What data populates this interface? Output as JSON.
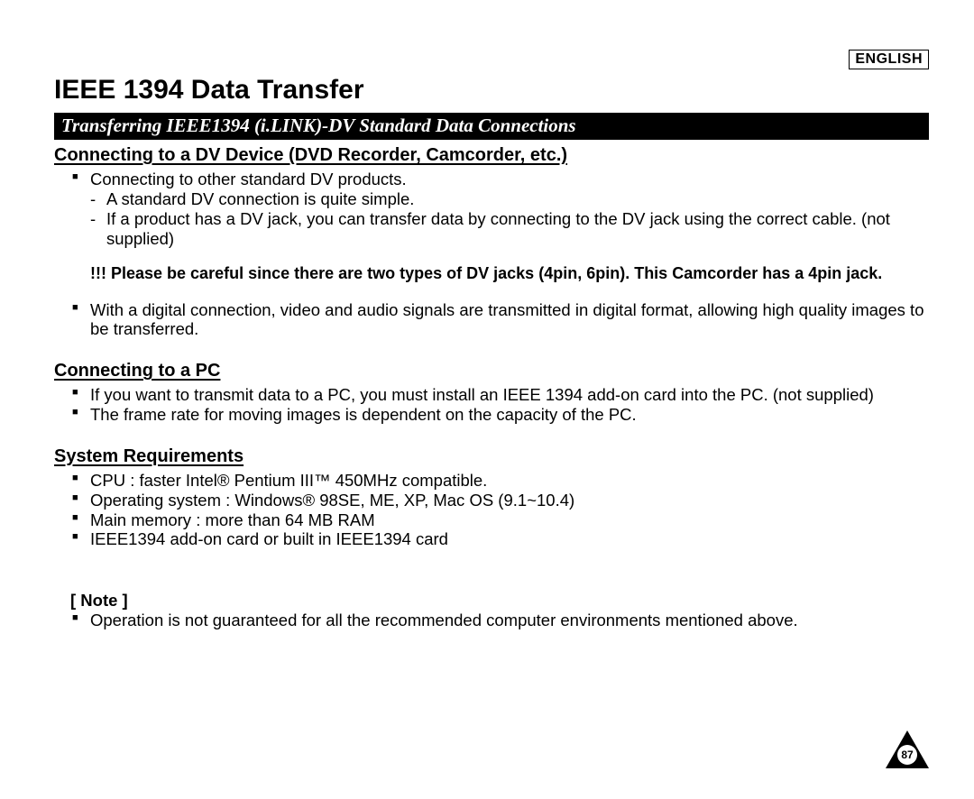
{
  "language_label": "ENGLISH",
  "page_title": "IEEE 1394 Data Transfer",
  "subtitle": "Transferring IEEE1394 (i.LINK)-DV Standard Data Connections",
  "section1": {
    "heading": "Connecting to a DV Device (DVD Recorder, Camcorder, etc.)",
    "bullet1": "Connecting to other standard DV products.",
    "dash1": "A standard DV connection is quite simple.",
    "dash2": "If a product has a DV jack, you can transfer data by connecting to the DV jack using the correct cable. (not supplied)",
    "warning": "!!! Please be careful since there are two types of DV jacks (4pin, 6pin). This Camcorder has a 4pin jack.",
    "bullet2": "With a digital connection, video and audio signals are transmitted in digital format, allowing high quality images to be transferred."
  },
  "section2": {
    "heading": "Connecting to a PC",
    "bullet1": "If you want to transmit data to a PC, you must install an IEEE 1394 add-on card into the PC. (not supplied)",
    "bullet2": "The frame rate for moving images is dependent on the capacity of the PC."
  },
  "section3": {
    "heading": "System Requirements",
    "bullet1": "CPU : faster Intel® Pentium III™ 450MHz compatible.",
    "bullet2": "Operating system : Windows® 98SE, ME, XP, Mac OS (9.1~10.4)",
    "bullet3": "Main memory : more than 64 MB RAM",
    "bullet4": "IEEE1394 add-on card or built in IEEE1394 card"
  },
  "note": {
    "label": "[ Note ]",
    "bullet1": "Operation is not guaranteed for all the recommended computer environments mentioned above."
  },
  "page_number": "87"
}
